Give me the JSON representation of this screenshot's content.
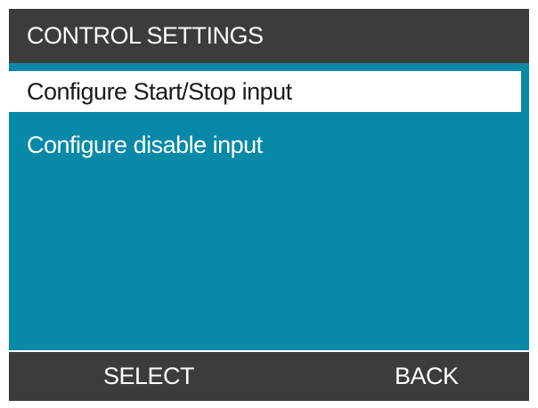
{
  "header": {
    "title": "CONTROL SETTINGS"
  },
  "menu": {
    "items": [
      {
        "label": "Configure Start/Stop input",
        "selected": true
      },
      {
        "label": "Configure disable input",
        "selected": false
      }
    ]
  },
  "softkeys": {
    "left_label": "SELECT",
    "right_label": "BACK"
  },
  "colors": {
    "header_bg": "#3c3c3b",
    "screen_bg": "#0889a8",
    "selected_bg": "#ffffff",
    "text": "#ffffff"
  }
}
